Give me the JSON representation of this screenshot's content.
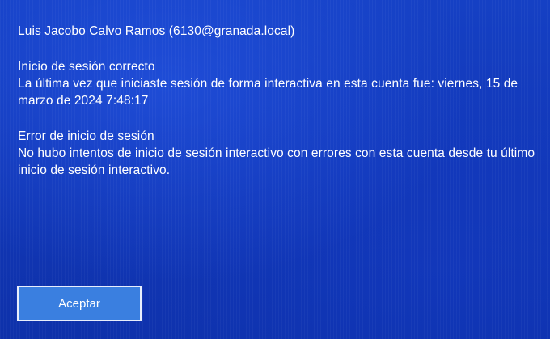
{
  "account": {
    "display": "Luis Jacobo Calvo Ramos (6130@granada.local)"
  },
  "success": {
    "heading": "Inicio de sesión correcto",
    "body": "La última vez que iniciaste sesión de forma interactiva en esta cuenta fue: viernes, 15 de marzo de 2024 7:48:17"
  },
  "failure": {
    "heading": "Error de inicio de sesión",
    "body": "No hubo intentos de inicio de sesión interactivo con errores con esta cuenta desde tu último inicio de sesión interactivo."
  },
  "actions": {
    "accept_label": "Aceptar"
  },
  "colors": {
    "background": "#1238b8",
    "button": "#3a7fe0",
    "text": "#ffffff"
  }
}
